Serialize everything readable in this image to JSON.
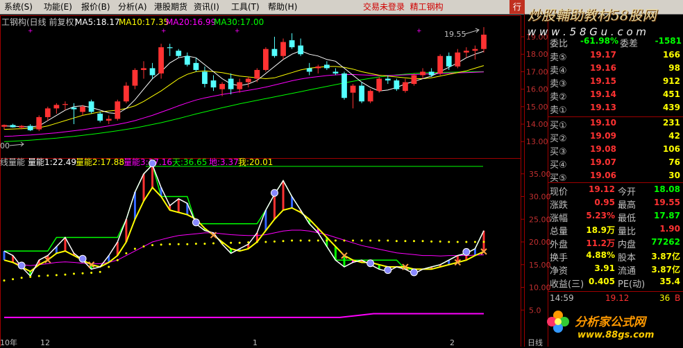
{
  "menu": {
    "items": [
      "系统(S)",
      "功能(E)",
      "报价(B)",
      "分析(A)",
      "港股期货",
      "资讯(I)",
      "工具(T)",
      "帮助(H)"
    ],
    "login_status": "交易未登录",
    "stock_short": "精工钢构",
    "corner_label": "行"
  },
  "watermark": {
    "top_title": "炒股輔助教材58股网",
    "top_url": "w w w . 5 8 G u . c o m",
    "bottom_title": "分析家公式网",
    "bottom_url": "www.88gs.com"
  },
  "price_chart": {
    "header": {
      "stock_name": "工钢构(日线 前复权)",
      "ma5": "MA5:18.17",
      "ma10": "MA10:17.35",
      "ma20": "MA20:16.99",
      "ma30": "MA30:17.00"
    },
    "y_ticks": [
      "19.00",
      "18.00",
      "17.00",
      "16.00",
      "15.00",
      "14.00",
      "13.00"
    ],
    "high_marker": "19.55",
    "low_marker": "00",
    "colors": {
      "up": "#ff3232",
      "down": "#54ffff",
      "ma5": "#ffffff",
      "ma10": "#ffff00",
      "ma20": "#ff00ff",
      "ma30": "#00ff00"
    },
    "candles": [
      {
        "o": 13.85,
        "h": 13.98,
        "l": 13.7,
        "c": 13.95
      },
      {
        "o": 13.95,
        "h": 14.02,
        "l": 13.8,
        "c": 13.82
      },
      {
        "o": 13.8,
        "h": 13.95,
        "l": 13.7,
        "c": 13.9
      },
      {
        "o": 13.9,
        "h": 14.0,
        "l": 13.6,
        "c": 13.65
      },
      {
        "o": 13.7,
        "h": 14.5,
        "l": 13.6,
        "c": 14.4
      },
      {
        "o": 14.4,
        "h": 15.0,
        "l": 14.2,
        "c": 14.9
      },
      {
        "o": 14.9,
        "h": 15.2,
        "l": 14.6,
        "c": 15.1
      },
      {
        "o": 15.1,
        "h": 15.3,
        "l": 14.8,
        "c": 15.15
      },
      {
        "o": 14.95,
        "h": 15.2,
        "l": 14.0,
        "c": 14.85
      },
      {
        "o": 14.7,
        "h": 15.1,
        "l": 14.5,
        "c": 15.0
      },
      {
        "o": 15.3,
        "h": 15.4,
        "l": 14.6,
        "c": 14.7
      },
      {
        "o": 14.6,
        "h": 14.7,
        "l": 14.1,
        "c": 14.2
      },
      {
        "o": 14.2,
        "h": 14.5,
        "l": 14.0,
        "c": 14.3
      },
      {
        "o": 14.3,
        "h": 15.4,
        "l": 14.2,
        "c": 15.3
      },
      {
        "o": 15.3,
        "h": 16.4,
        "l": 15.2,
        "c": 16.2
      },
      {
        "o": 16.2,
        "h": 17.2,
        "l": 16.0,
        "c": 17.1
      },
      {
        "o": 17.1,
        "h": 17.6,
        "l": 16.6,
        "c": 17.2
      },
      {
        "o": 17.2,
        "h": 17.5,
        "l": 16.6,
        "c": 16.8
      },
      {
        "o": 16.9,
        "h": 18.6,
        "l": 16.6,
        "c": 18.4
      },
      {
        "o": 18.4,
        "h": 18.6,
        "l": 17.9,
        "c": 18.35
      },
      {
        "o": 18.2,
        "h": 18.3,
        "l": 17.8,
        "c": 17.9
      },
      {
        "o": 17.9,
        "h": 18.1,
        "l": 17.3,
        "c": 17.4
      },
      {
        "o": 17.5,
        "h": 17.8,
        "l": 17.0,
        "c": 17.1
      },
      {
        "o": 17.0,
        "h": 17.3,
        "l": 16.1,
        "c": 16.3
      },
      {
        "o": 16.5,
        "h": 16.8,
        "l": 15.9,
        "c": 16.1
      },
      {
        "o": 16.0,
        "h": 16.4,
        "l": 15.6,
        "c": 16.3
      },
      {
        "o": 16.6,
        "h": 16.9,
        "l": 15.7,
        "c": 16.0
      },
      {
        "o": 16.0,
        "h": 16.6,
        "l": 15.8,
        "c": 16.4
      },
      {
        "o": 16.4,
        "h": 16.7,
        "l": 16.1,
        "c": 16.6
      },
      {
        "o": 16.6,
        "h": 17.2,
        "l": 16.4,
        "c": 17.1
      },
      {
        "o": 17.1,
        "h": 18.4,
        "l": 17.0,
        "c": 18.3
      },
      {
        "o": 18.3,
        "h": 19.0,
        "l": 17.8,
        "c": 17.9
      },
      {
        "o": 17.9,
        "h": 18.9,
        "l": 17.7,
        "c": 18.7
      },
      {
        "o": 18.8,
        "h": 19.2,
        "l": 18.3,
        "c": 18.4
      },
      {
        "o": 18.5,
        "h": 18.9,
        "l": 17.9,
        "c": 18.0
      },
      {
        "o": 17.2,
        "h": 17.5,
        "l": 16.8,
        "c": 17.0
      },
      {
        "o": 17.2,
        "h": 17.4,
        "l": 16.9,
        "c": 17.3
      },
      {
        "o": 17.4,
        "h": 17.6,
        "l": 17.1,
        "c": 17.2
      },
      {
        "o": 17.0,
        "h": 17.2,
        "l": 16.8,
        "c": 16.9
      },
      {
        "o": 16.9,
        "h": 17.0,
        "l": 15.4,
        "c": 15.5
      },
      {
        "o": 15.8,
        "h": 16.3,
        "l": 14.9,
        "c": 16.2
      },
      {
        "o": 16.2,
        "h": 16.4,
        "l": 15.2,
        "c": 15.3
      },
      {
        "o": 15.3,
        "h": 16.0,
        "l": 15.2,
        "c": 15.9
      },
      {
        "o": 15.9,
        "h": 16.7,
        "l": 15.8,
        "c": 16.6
      },
      {
        "o": 16.6,
        "h": 16.8,
        "l": 16.3,
        "c": 16.5
      },
      {
        "o": 16.5,
        "h": 16.6,
        "l": 15.9,
        "c": 16.0
      },
      {
        "o": 15.9,
        "h": 16.6,
        "l": 15.8,
        "c": 16.4
      },
      {
        "o": 16.3,
        "h": 16.9,
        "l": 16.2,
        "c": 16.8
      },
      {
        "o": 16.8,
        "h": 17.2,
        "l": 16.6,
        "c": 17.0
      },
      {
        "o": 17.0,
        "h": 17.2,
        "l": 16.7,
        "c": 16.8
      },
      {
        "o": 16.9,
        "h": 18.0,
        "l": 16.8,
        "c": 17.9
      },
      {
        "o": 17.9,
        "h": 18.1,
        "l": 17.1,
        "c": 17.3
      },
      {
        "o": 17.3,
        "h": 18.3,
        "l": 17.2,
        "c": 18.1
      },
      {
        "o": 18.1,
        "h": 18.4,
        "l": 17.8,
        "c": 18.2
      },
      {
        "o": 18.2,
        "h": 18.5,
        "l": 17.7,
        "c": 18.3
      },
      {
        "o": 18.3,
        "h": 19.55,
        "l": 18.1,
        "c": 19.12
      }
    ],
    "ma": {
      "ma5": [
        13.9,
        13.88,
        13.86,
        13.84,
        13.9,
        14.2,
        14.5,
        14.8,
        15.0,
        15.05,
        14.95,
        14.8,
        14.65,
        14.6,
        14.9,
        15.4,
        16.0,
        16.6,
        17.0,
        17.5,
        17.8,
        17.9,
        17.8,
        17.4,
        17.0,
        16.6,
        16.3,
        16.2,
        16.3,
        16.5,
        16.9,
        17.3,
        17.7,
        18.0,
        18.2,
        18.0,
        17.9,
        17.7,
        17.6,
        17.2,
        16.8,
        16.4,
        16.1,
        15.9,
        15.95,
        16.1,
        16.3,
        16.45,
        16.6,
        16.75,
        17.0,
        17.25,
        17.5,
        17.8,
        18.0,
        18.17
      ],
      "ma10": [
        13.7,
        13.72,
        13.74,
        13.76,
        13.8,
        13.9,
        14.05,
        14.2,
        14.35,
        14.5,
        14.6,
        14.7,
        14.75,
        14.8,
        14.9,
        15.05,
        15.3,
        15.6,
        15.9,
        16.25,
        16.6,
        16.85,
        17.0,
        17.05,
        17.0,
        16.95,
        16.85,
        16.75,
        16.7,
        16.65,
        16.6,
        16.65,
        16.8,
        16.95,
        17.1,
        17.2,
        17.25,
        17.3,
        17.3,
        17.25,
        17.15,
        17.0,
        16.9,
        16.8,
        16.75,
        16.7,
        16.65,
        16.6,
        16.6,
        16.65,
        16.75,
        16.85,
        16.95,
        17.05,
        17.2,
        17.35
      ],
      "ma20": [
        13.3,
        13.32,
        13.35,
        13.38,
        13.42,
        13.46,
        13.5,
        13.56,
        13.62,
        13.68,
        13.75,
        13.82,
        13.9,
        13.98,
        14.08,
        14.2,
        14.35,
        14.5,
        14.68,
        14.86,
        15.05,
        15.22,
        15.38,
        15.5,
        15.6,
        15.7,
        15.78,
        15.86,
        15.94,
        16.02,
        16.12,
        16.24,
        16.36,
        16.48,
        16.58,
        16.66,
        16.72,
        16.78,
        16.82,
        16.84,
        16.84,
        16.82,
        16.8,
        16.78,
        16.78,
        16.8,
        16.82,
        16.84,
        16.86,
        16.88,
        16.9,
        16.92,
        16.94,
        16.95,
        16.97,
        16.99
      ],
      "ma30": [
        13.0,
        13.02,
        13.05,
        13.08,
        13.12,
        13.16,
        13.2,
        13.25,
        13.3,
        13.36,
        13.42,
        13.48,
        13.55,
        13.62,
        13.7,
        13.78,
        13.88,
        13.98,
        14.08,
        14.2,
        14.32,
        14.45,
        14.58,
        14.7,
        14.82,
        14.94,
        15.05,
        15.16,
        15.26,
        15.36,
        15.46,
        15.56,
        15.66,
        15.76,
        15.86,
        15.96,
        16.06,
        16.16,
        16.26,
        16.36,
        16.45,
        16.54,
        16.62,
        16.7,
        16.76,
        16.82,
        16.86,
        16.9,
        16.93,
        16.95,
        16.96,
        16.97,
        16.98,
        16.99,
        17.0,
        17.0
      ]
    }
  },
  "indicator_chart": {
    "header": {
      "name": "线量能",
      "l1": "量能1:22.49",
      "l2": "量能2:17.88",
      "l3": "量能3:17.16",
      "tian": "天:36.65",
      "di": "地:3.37",
      "wo": "我:20.01"
    },
    "y_ticks": [
      "35.00",
      "30.00",
      "25.00",
      "20.00",
      "15.00",
      "10.00",
      "5.0"
    ],
    "tian_value": 36.65,
    "colors": {
      "l1": "#ffffff",
      "l2": "#ffff00",
      "l3": "#ff00ff",
      "tian": "#00ff00",
      "di": "#ff00ff",
      "wo": "#ffff00"
    },
    "l1": [
      18.0,
      17.0,
      14.5,
      12.5,
      16.0,
      17.0,
      19.0,
      21.0,
      17.5,
      16.0,
      14.0,
      14.5,
      17.0,
      20.0,
      25.0,
      31.0,
      35.0,
      37.0,
      32.0,
      28.0,
      29.5,
      28.5,
      24.0,
      22.5,
      22.0,
      19.5,
      17.5,
      18.5,
      19.5,
      22.0,
      27.0,
      30.5,
      33.5,
      30.0,
      27.0,
      24.0,
      22.0,
      19.0,
      16.0,
      14.5,
      15.5,
      16.0,
      15.0,
      14.0,
      13.5,
      14.5,
      14.0,
      13.0,
      14.0,
      14.5,
      15.0,
      16.0,
      17.0,
      17.5,
      18.5,
      22.49
    ],
    "l2": [
      16.0,
      15.5,
      14.5,
      13.5,
      15.0,
      16.0,
      17.5,
      18.0,
      17.0,
      16.0,
      15.0,
      14.5,
      15.5,
      17.0,
      20.0,
      25.0,
      29.0,
      32.0,
      30.0,
      27.0,
      26.5,
      26.0,
      25.0,
      23.0,
      21.5,
      20.0,
      18.5,
      18.0,
      18.5,
      20.0,
      22.5,
      25.0,
      27.0,
      27.5,
      26.5,
      25.0,
      23.0,
      21.0,
      19.0,
      17.0,
      16.0,
      15.5,
      15.5,
      15.0,
      14.5,
      14.5,
      14.5,
      14.0,
      14.0,
      14.0,
      14.5,
      15.0,
      15.5,
      16.0,
      17.0,
      17.88
    ],
    "l3": [
      16.0,
      15.5,
      15.0,
      14.8,
      15.0,
      15.2,
      15.5,
      15.6,
      15.5,
      15.3,
      15.2,
      15.2,
      15.5,
      16.0,
      17.0,
      18.0,
      19.0,
      20.0,
      20.5,
      21.0,
      21.4,
      21.6,
      21.8,
      22.0,
      22.0,
      21.8,
      21.6,
      21.5,
      21.4,
      21.4,
      21.6,
      22.0,
      22.4,
      22.6,
      22.6,
      22.4,
      22.0,
      21.6,
      21.0,
      20.4,
      19.8,
      19.2,
      18.8,
      18.4,
      18.0,
      17.6,
      17.4,
      17.2,
      17.0,
      17.0,
      16.9,
      17.0,
      17.0,
      17.0,
      17.1,
      17.16
    ],
    "tian_stair": [
      18.0,
      18.0,
      18.0,
      18.0,
      18.0,
      18.0,
      21.0,
      21.0,
      21.0,
      21.0,
      21.0,
      21.0,
      21.0,
      21.0,
      25.0,
      31.0,
      35.0,
      37.0,
      30.0,
      30.0,
      30.0,
      30.0,
      24.0,
      24.0,
      24.0,
      24.0,
      24.0,
      24.0,
      24.0,
      24.0,
      27.0,
      30.5,
      33.5,
      30.0,
      27.0,
      24.0,
      22.0,
      19.0,
      16.0,
      16.0,
      16.0,
      16.0,
      16.0,
      16.0,
      16.0,
      16.0,
      14.0,
      14.0,
      14.0,
      14.5,
      15.0,
      16.0,
      17.0,
      17.5,
      18.5,
      22.49
    ],
    "di_line": [
      {
        "x": 0,
        "y": 3.37
      },
      {
        "x": 0.7,
        "y": 3.37
      },
      {
        "x": 0.77,
        "y": 4.2
      },
      {
        "x": 1,
        "y": 4.2
      }
    ],
    "wo_dots": [
      11.5,
      11.8,
      12.1,
      12.3,
      12.5,
      12.6,
      12.7,
      12.8,
      13.0,
      13.1,
      13.2,
      13.4,
      14.5,
      16.0,
      17.5,
      18.5,
      19.0,
      19.3,
      19.4,
      19.5,
      19.5,
      19.5,
      19.6,
      19.6,
      19.7,
      19.7,
      19.8,
      19.8,
      19.9,
      20.0,
      20.0,
      20.1,
      20.2,
      20.3,
      20.3,
      20.3,
      20.3,
      20.3,
      20.3,
      20.3,
      20.3,
      20.3,
      20.3,
      20.3,
      20.3,
      20.2,
      20.2,
      20.2,
      20.2,
      20.1,
      20.1,
      20.0,
      20.0,
      20.0,
      20.0,
      20.01
    ],
    "date_labels": [
      "10年",
      "12",
      "1",
      "2"
    ]
  },
  "order_book": {
    "sells": [
      {
        "label": "卖⑤",
        "price": "19.17",
        "vol": "166"
      },
      {
        "label": "卖④",
        "price": "19.16",
        "vol": "98"
      },
      {
        "label": "卖③",
        "price": "19.15",
        "vol": "912"
      },
      {
        "label": "卖②",
        "price": "19.14",
        "vol": "451"
      },
      {
        "label": "卖①",
        "price": "19.13",
        "vol": "439"
      }
    ],
    "buys": [
      {
        "label": "买①",
        "price": "19.10",
        "vol": "231"
      },
      {
        "label": "买②",
        "price": "19.09",
        "vol": "42"
      },
      {
        "label": "买③",
        "price": "19.08",
        "vol": "106"
      },
      {
        "label": "买④",
        "price": "19.07",
        "vol": "76"
      },
      {
        "label": "买⑤",
        "price": "19.06",
        "vol": "30"
      }
    ],
    "webi_label": "委比",
    "webi_value": "-61.98%",
    "weicha_label": "委差",
    "weicha_value": "-1581",
    "stats": [
      {
        "l1": "现价",
        "v1": "19.12",
        "l2": "今开",
        "v2": "18.08",
        "c1": "#ff3232",
        "c2": "#00ff00"
      },
      {
        "l1": "涨跌",
        "v1": "0.95",
        "l2": "最高",
        "v2": "19.55",
        "c1": "#ff3232",
        "c2": "#ff3232"
      },
      {
        "l1": "涨幅",
        "v1": "5.23%",
        "l2": "最低",
        "v2": "17.87",
        "c1": "#ff3232",
        "c2": "#00ff00"
      },
      {
        "l1": "总量",
        "v1": "18.9万",
        "l2": "量比",
        "v2": "1.90",
        "c1": "#ffff00",
        "c2": "#ff3232"
      },
      {
        "l1": "外盘",
        "v1": "11.2万",
        "l2": "内盘",
        "v2": "77262",
        "c1": "#ff3232",
        "c2": "#00ff00"
      },
      {
        "l1": "换手",
        "v1": "4.88%",
        "l2": "股本",
        "v2": "3.87亿",
        "c1": "#ffff00",
        "c2": "#ffff00"
      },
      {
        "l1": "净资",
        "v1": "3.91",
        "l2": "流通",
        "v2": "3.87亿",
        "c1": "#ffff00",
        "c2": "#ffff00"
      },
      {
        "l1": "收益(三)",
        "v1": "0.405",
        "l2": "PE(动)",
        "v2": "35.4",
        "c1": "#ffff00",
        "c2": "#ffff00"
      }
    ],
    "tick": {
      "time": "14:59",
      "price": "19.12",
      "vol": "36",
      "side": "B"
    },
    "footer": "日线"
  }
}
